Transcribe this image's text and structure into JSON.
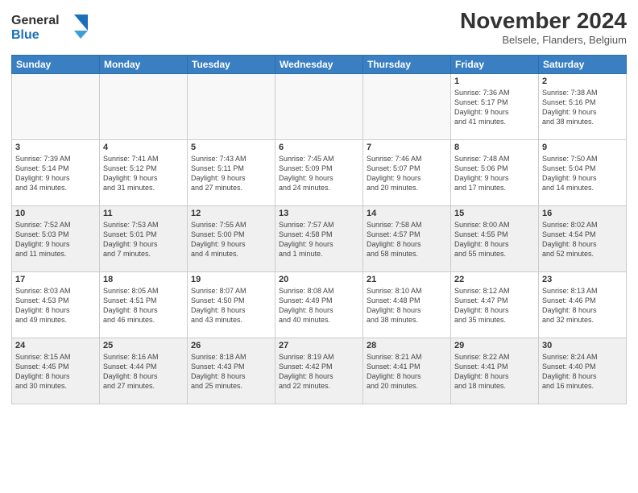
{
  "header": {
    "logo_line1": "General",
    "logo_line2": "Blue",
    "month_year": "November 2024",
    "location": "Belsele, Flanders, Belgium"
  },
  "weekdays": [
    "Sunday",
    "Monday",
    "Tuesday",
    "Wednesday",
    "Thursday",
    "Friday",
    "Saturday"
  ],
  "weeks": [
    [
      {
        "day": "",
        "info": "",
        "empty": true
      },
      {
        "day": "",
        "info": "",
        "empty": true
      },
      {
        "day": "",
        "info": "",
        "empty": true
      },
      {
        "day": "",
        "info": "",
        "empty": true
      },
      {
        "day": "",
        "info": "",
        "empty": true
      },
      {
        "day": "1",
        "info": "Sunrise: 7:36 AM\nSunset: 5:17 PM\nDaylight: 9 hours\nand 41 minutes."
      },
      {
        "day": "2",
        "info": "Sunrise: 7:38 AM\nSunset: 5:16 PM\nDaylight: 9 hours\nand 38 minutes."
      }
    ],
    [
      {
        "day": "3",
        "info": "Sunrise: 7:39 AM\nSunset: 5:14 PM\nDaylight: 9 hours\nand 34 minutes."
      },
      {
        "day": "4",
        "info": "Sunrise: 7:41 AM\nSunset: 5:12 PM\nDaylight: 9 hours\nand 31 minutes."
      },
      {
        "day": "5",
        "info": "Sunrise: 7:43 AM\nSunset: 5:11 PM\nDaylight: 9 hours\nand 27 minutes."
      },
      {
        "day": "6",
        "info": "Sunrise: 7:45 AM\nSunset: 5:09 PM\nDaylight: 9 hours\nand 24 minutes."
      },
      {
        "day": "7",
        "info": "Sunrise: 7:46 AM\nSunset: 5:07 PM\nDaylight: 9 hours\nand 20 minutes."
      },
      {
        "day": "8",
        "info": "Sunrise: 7:48 AM\nSunset: 5:06 PM\nDaylight: 9 hours\nand 17 minutes."
      },
      {
        "day": "9",
        "info": "Sunrise: 7:50 AM\nSunset: 5:04 PM\nDaylight: 9 hours\nand 14 minutes."
      }
    ],
    [
      {
        "day": "10",
        "info": "Sunrise: 7:52 AM\nSunset: 5:03 PM\nDaylight: 9 hours\nand 11 minutes."
      },
      {
        "day": "11",
        "info": "Sunrise: 7:53 AM\nSunset: 5:01 PM\nDaylight: 9 hours\nand 7 minutes."
      },
      {
        "day": "12",
        "info": "Sunrise: 7:55 AM\nSunset: 5:00 PM\nDaylight: 9 hours\nand 4 minutes."
      },
      {
        "day": "13",
        "info": "Sunrise: 7:57 AM\nSunset: 4:58 PM\nDaylight: 9 hours\nand 1 minute."
      },
      {
        "day": "14",
        "info": "Sunrise: 7:58 AM\nSunset: 4:57 PM\nDaylight: 8 hours\nand 58 minutes."
      },
      {
        "day": "15",
        "info": "Sunrise: 8:00 AM\nSunset: 4:55 PM\nDaylight: 8 hours\nand 55 minutes."
      },
      {
        "day": "16",
        "info": "Sunrise: 8:02 AM\nSunset: 4:54 PM\nDaylight: 8 hours\nand 52 minutes."
      }
    ],
    [
      {
        "day": "17",
        "info": "Sunrise: 8:03 AM\nSunset: 4:53 PM\nDaylight: 8 hours\nand 49 minutes."
      },
      {
        "day": "18",
        "info": "Sunrise: 8:05 AM\nSunset: 4:51 PM\nDaylight: 8 hours\nand 46 minutes."
      },
      {
        "day": "19",
        "info": "Sunrise: 8:07 AM\nSunset: 4:50 PM\nDaylight: 8 hours\nand 43 minutes."
      },
      {
        "day": "20",
        "info": "Sunrise: 8:08 AM\nSunset: 4:49 PM\nDaylight: 8 hours\nand 40 minutes."
      },
      {
        "day": "21",
        "info": "Sunrise: 8:10 AM\nSunset: 4:48 PM\nDaylight: 8 hours\nand 38 minutes."
      },
      {
        "day": "22",
        "info": "Sunrise: 8:12 AM\nSunset: 4:47 PM\nDaylight: 8 hours\nand 35 minutes."
      },
      {
        "day": "23",
        "info": "Sunrise: 8:13 AM\nSunset: 4:46 PM\nDaylight: 8 hours\nand 32 minutes."
      }
    ],
    [
      {
        "day": "24",
        "info": "Sunrise: 8:15 AM\nSunset: 4:45 PM\nDaylight: 8 hours\nand 30 minutes."
      },
      {
        "day": "25",
        "info": "Sunrise: 8:16 AM\nSunset: 4:44 PM\nDaylight: 8 hours\nand 27 minutes."
      },
      {
        "day": "26",
        "info": "Sunrise: 8:18 AM\nSunset: 4:43 PM\nDaylight: 8 hours\nand 25 minutes."
      },
      {
        "day": "27",
        "info": "Sunrise: 8:19 AM\nSunset: 4:42 PM\nDaylight: 8 hours\nand 22 minutes."
      },
      {
        "day": "28",
        "info": "Sunrise: 8:21 AM\nSunset: 4:41 PM\nDaylight: 8 hours\nand 20 minutes."
      },
      {
        "day": "29",
        "info": "Sunrise: 8:22 AM\nSunset: 4:41 PM\nDaylight: 8 hours\nand 18 minutes."
      },
      {
        "day": "30",
        "info": "Sunrise: 8:24 AM\nSunset: 4:40 PM\nDaylight: 8 hours\nand 16 minutes."
      }
    ]
  ]
}
